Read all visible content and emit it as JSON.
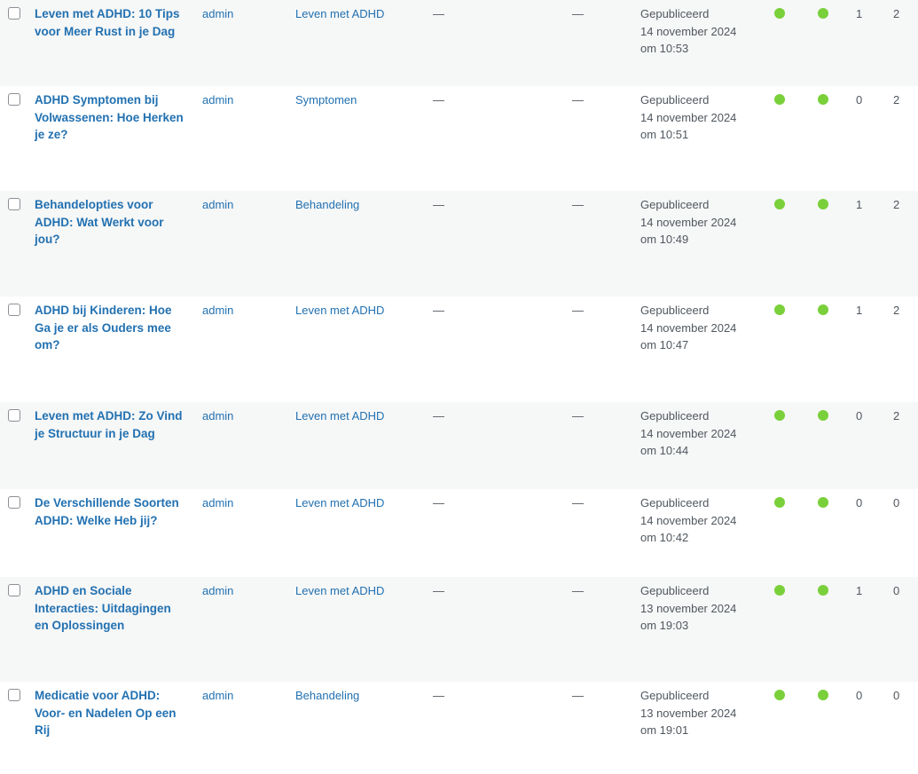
{
  "colors": {
    "link": "#2271b1",
    "text": "#50575e",
    "alt_row": "#f6f7f7",
    "status_dot": "#7ad03a"
  },
  "posts": [
    {
      "title": "Leven met ADHD: 10 Tips voor Meer Rust in je Dag",
      "author": "admin",
      "category": "Leven met ADHD",
      "tags": "—",
      "comments": "—",
      "status": "Gepubliceerd",
      "date": "14 november 2024",
      "time": "om 10:53",
      "count1": "1",
      "count2": "2"
    },
    {
      "title": "ADHD Symptomen bij Volwassenen: Hoe Herken je ze?",
      "author": "admin",
      "category": "Symptomen",
      "tags": "—",
      "comments": "—",
      "status": "Gepubliceerd",
      "date": "14 november 2024",
      "time": "om 10:51",
      "count1": "0",
      "count2": "2"
    },
    {
      "title": "Behandelopties voor ADHD: Wat Werkt voor jou?",
      "author": "admin",
      "category": "Behandeling",
      "tags": "—",
      "comments": "—",
      "status": "Gepubliceerd",
      "date": "14 november 2024",
      "time": "om 10:49",
      "count1": "1",
      "count2": "2"
    },
    {
      "title": "ADHD bij Kinderen: Hoe Ga je er als Ouders mee om?",
      "author": "admin",
      "category": "Leven met ADHD",
      "tags": "—",
      "comments": "—",
      "status": "Gepubliceerd",
      "date": "14 november 2024",
      "time": "om 10:47",
      "count1": "1",
      "count2": "2"
    },
    {
      "title": "Leven met ADHD: Zo Vind je Structuur in je Dag",
      "author": "admin",
      "category": "Leven met ADHD",
      "tags": "—",
      "comments": "—",
      "status": "Gepubliceerd",
      "date": "14 november 2024",
      "time": "om 10:44",
      "count1": "0",
      "count2": "2"
    },
    {
      "title": "De Verschillende Soorten ADHD: Welke Heb jij?",
      "author": "admin",
      "category": "Leven met ADHD",
      "tags": "—",
      "comments": "—",
      "status": "Gepubliceerd",
      "date": "14 november 2024",
      "time": "om 10:42",
      "count1": "0",
      "count2": "0"
    },
    {
      "title": "ADHD en Sociale Interacties: Uitdagingen en Oplossingen",
      "author": "admin",
      "category": "Leven met ADHD",
      "tags": "—",
      "comments": "—",
      "status": "Gepubliceerd",
      "date": "13 november 2024",
      "time": "om 19:03",
      "count1": "1",
      "count2": "0"
    },
    {
      "title": "Medicatie voor ADHD: Voor- en Nadelen Op een Rij",
      "author": "admin",
      "category": "Behandeling",
      "tags": "—",
      "comments": "—",
      "status": "Gepubliceerd",
      "date": "13 november 2024",
      "time": "om 19:01",
      "count1": "0",
      "count2": "0"
    }
  ]
}
